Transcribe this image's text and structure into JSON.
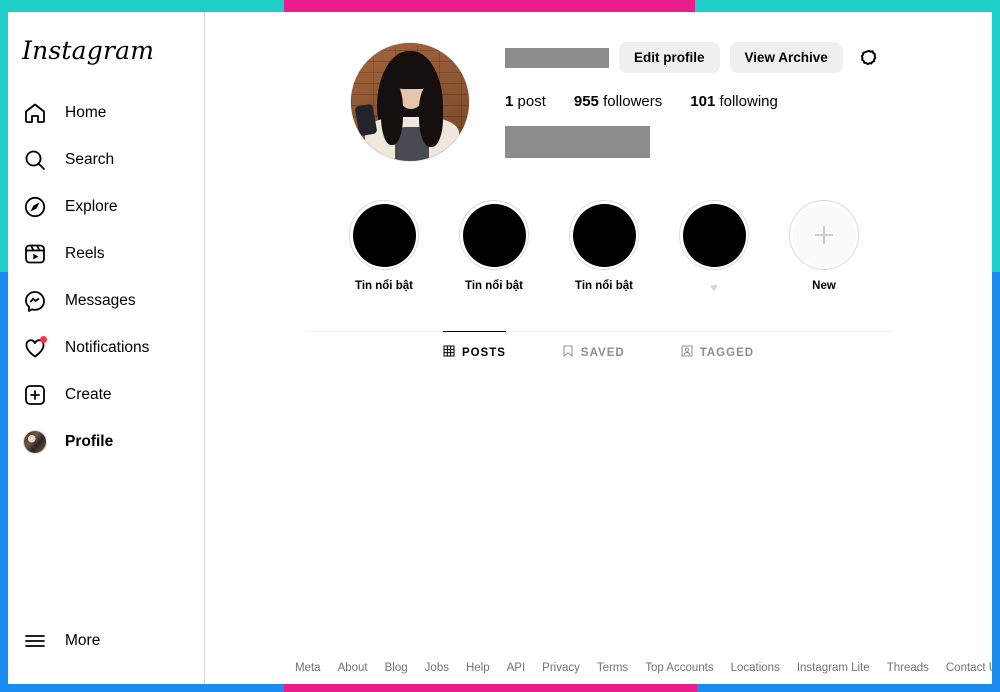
{
  "borders": {
    "teal": "#1ecfc9",
    "pink": "#e91e8c",
    "blue": "#1a8cf0"
  },
  "sidebar": {
    "logo": "Instagram",
    "items": [
      {
        "label": "Home",
        "icon": "home-icon"
      },
      {
        "label": "Search",
        "icon": "search-icon"
      },
      {
        "label": "Explore",
        "icon": "compass-icon"
      },
      {
        "label": "Reels",
        "icon": "reels-icon"
      },
      {
        "label": "Messages",
        "icon": "messenger-icon"
      },
      {
        "label": "Notifications",
        "icon": "heart-icon"
      },
      {
        "label": "Create",
        "icon": "plus-square-icon"
      },
      {
        "label": "Profile",
        "icon": "avatar-icon"
      }
    ],
    "more": {
      "label": "More",
      "icon": "hamburger-icon"
    }
  },
  "profile": {
    "username_redacted": "",
    "bio_redacted": "",
    "edit_profile_label": "Edit profile",
    "view_archive_label": "View Archive",
    "settings_icon": "gear-icon",
    "stats": [
      {
        "value": "1",
        "label": "post"
      },
      {
        "value": "955",
        "label": "followers"
      },
      {
        "value": "101",
        "label": "following"
      }
    ],
    "highlights": [
      {
        "label": "Tin nổi bật",
        "type": "story"
      },
      {
        "label": "Tin nổi bật",
        "type": "story"
      },
      {
        "label": "Tin nổi bật",
        "type": "story"
      },
      {
        "label": "♥",
        "type": "story-emoji"
      },
      {
        "label": "New",
        "type": "new"
      }
    ]
  },
  "tabs": [
    {
      "label": "POSTS",
      "icon": "grid-icon",
      "active": true
    },
    {
      "label": "SAVED",
      "icon": "bookmark-icon",
      "active": false
    },
    {
      "label": "TAGGED",
      "icon": "tagged-icon",
      "active": false
    }
  ],
  "footer": {
    "links": [
      "Meta",
      "About",
      "Blog",
      "Jobs",
      "Help",
      "API",
      "Privacy",
      "Terms",
      "Top Accounts",
      "Locations",
      "Instagram Lite",
      "Threads",
      "Contact Uploading & Non-"
    ]
  }
}
